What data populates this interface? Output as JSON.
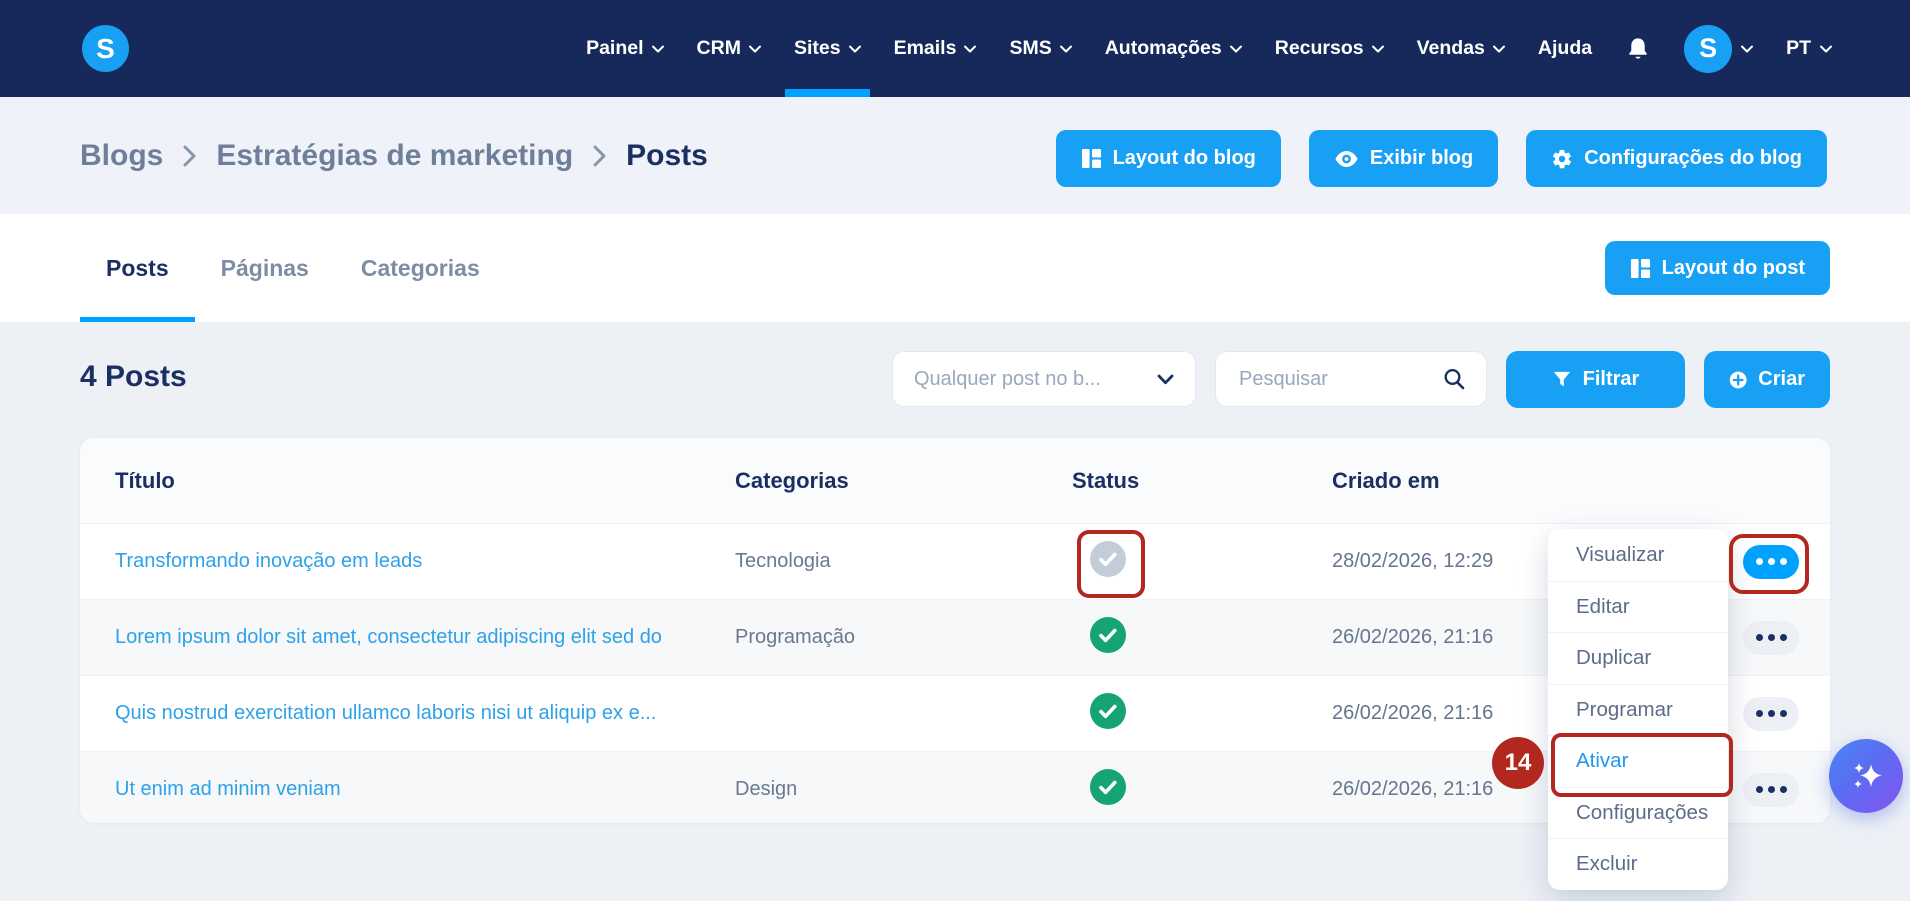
{
  "nav": {
    "logo_letter": "S",
    "items": [
      {
        "label": "Painel"
      },
      {
        "label": "CRM"
      },
      {
        "label": "Sites",
        "active": true
      },
      {
        "label": "Emails"
      },
      {
        "label": "SMS"
      },
      {
        "label": "Automações"
      },
      {
        "label": "Recursos"
      },
      {
        "label": "Vendas"
      },
      {
        "label": "Ajuda"
      }
    ],
    "avatar_letter": "S",
    "language": "PT"
  },
  "breadcrumb": {
    "items": [
      "Blogs",
      "Estratégias de marketing",
      "Posts"
    ]
  },
  "blog_actions": {
    "layout": "Layout do blog",
    "view": "Exibir blog",
    "settings": "Configurações do blog"
  },
  "tabs": [
    {
      "label": "Posts",
      "active": true
    },
    {
      "label": "Páginas"
    },
    {
      "label": "Categorias"
    }
  ],
  "post_layout_button": "Layout do post",
  "toolbar": {
    "count_title": "4 Posts",
    "filter_dropdown_value": "Qualquer post no b...",
    "search_placeholder": "Pesquisar",
    "filter_button": "Filtrar",
    "create_button": "Criar"
  },
  "table": {
    "headers": [
      "Título",
      "Categorias",
      "Status",
      "Criado em"
    ],
    "rows": [
      {
        "title": "Transformando inovação em leads",
        "category": "Tecnologia",
        "status": "inactive",
        "created": "28/02/2026, 12:29"
      },
      {
        "title": "Lorem ipsum dolor sit amet, consectetur adipiscing elit sed do",
        "category": "Programação",
        "status": "active",
        "created": "26/02/2026, 21:16"
      },
      {
        "title": "Quis nostrud exercitation ullamco laboris nisi ut aliquip ex e...",
        "category": "",
        "status": "active",
        "created": "26/02/2026, 21:16"
      },
      {
        "title": "Ut enim ad minim veniam",
        "category": "Design",
        "status": "active",
        "created": "26/02/2026, 21:16"
      }
    ]
  },
  "context_menu": {
    "items": [
      "Visualizar",
      "Editar",
      "Duplicar",
      "Programar",
      "Ativar",
      "Configurações",
      "Excluir"
    ]
  },
  "annotation": {
    "step_number": "14",
    "color": "#B2271E"
  },
  "colors": {
    "nav_bg": "#16295A",
    "accent_blue": "#18A0F5",
    "underline_blue": "#00A1FF",
    "link_blue": "#2EA1E8",
    "green_status": "#16A476",
    "gray_status": "#C3CDDA",
    "annotation_red": "#B2271E"
  }
}
